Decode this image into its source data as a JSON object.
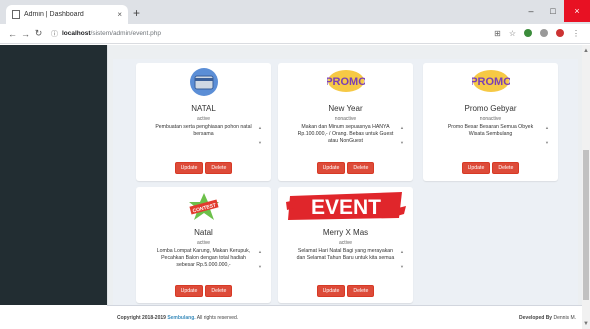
{
  "browser": {
    "tab_title": "Admin | Dashboard",
    "tab_close": "×",
    "new_tab": "+",
    "address_host": "localhost",
    "address_path": "/sistem/admin/event.php",
    "min": "–",
    "max": "□",
    "close": "×"
  },
  "events": [
    {
      "title": "NATAL",
      "status": "active",
      "description": "Pembuatan serta penghiasan pohon natal bersama",
      "image": "gift-card-icon"
    },
    {
      "title": "New Year",
      "status": "nonactive",
      "description": "Makan dan Minum sepuasnya HANYA Rp.100.000,- / Orang. Bebas untuk Guest atau NonGuest",
      "image": "promo-icon"
    },
    {
      "title": "Promo Gebyar",
      "status": "nonactive",
      "description": "Promo Besar Besaran Semua Obyek Wisata Sembulang",
      "image": "promo-icon"
    },
    {
      "title": "Natal",
      "status": "active",
      "description": "Lomba Lompat Karung, Makan Kerupuk, Pecahkan Balon dengan total hadiah sebesar Rp.5.000.000,-",
      "image": "contest-icon"
    },
    {
      "title": "Merry X Mas",
      "status": "active",
      "description": "Selamat Hari Natal Bagi yang merayakan dan Selamat Tahun Baru untuk kita semua",
      "image": "event-banner"
    }
  ],
  "buttons": {
    "update": "Update",
    "delete": "Delete"
  },
  "banner_text": {
    "promo": "PROMO",
    "contest": "CONTEST",
    "event": "EVENT"
  },
  "footer": {
    "copyright_prefix": "Copyright 2018-2019",
    "copyright_link": "Sembulang.",
    "copyright_suffix": "All rights reserved.",
    "developed_by": "Developed By",
    "developer": "Dennis M."
  },
  "colors": {
    "danger": "#dd4b39",
    "sidebar": "#222d32",
    "link": "#3c8dbc"
  }
}
